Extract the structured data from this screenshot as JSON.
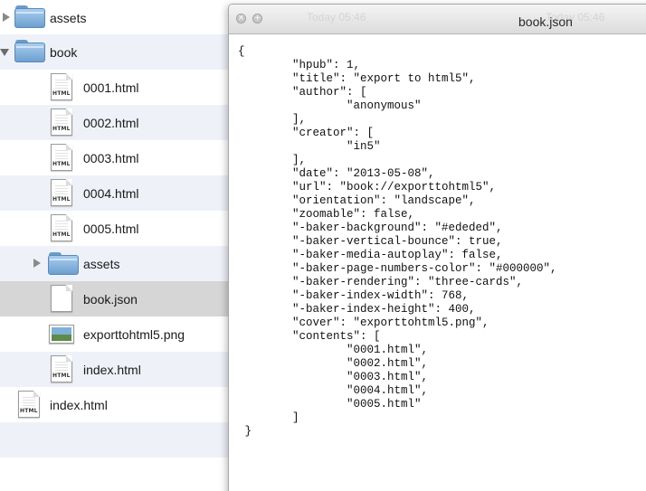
{
  "finder": {
    "rows": [
      {
        "label": "assets",
        "icon": "folder-icon"
      },
      {
        "label": "book",
        "icon": "folder-icon"
      },
      {
        "label": "0001.html",
        "icon": "html-file-icon",
        "badge": "HTML"
      },
      {
        "label": "0002.html",
        "icon": "html-file-icon",
        "badge": "HTML"
      },
      {
        "label": "0003.html",
        "icon": "html-file-icon",
        "badge": "HTML"
      },
      {
        "label": "0004.html",
        "icon": "html-file-icon",
        "badge": "HTML"
      },
      {
        "label": "0005.html",
        "icon": "html-file-icon",
        "badge": "HTML"
      },
      {
        "label": "assets",
        "icon": "folder-icon"
      },
      {
        "label": "book.json",
        "icon": "blank-file-icon",
        "selected": true
      },
      {
        "label": "exporttohtml5.png",
        "icon": "image-file-icon"
      },
      {
        "label": "index.html",
        "icon": "html-file-icon",
        "badge": "HTML"
      },
      {
        "label": "index.html",
        "icon": "html-file-icon",
        "badge": "HTML"
      }
    ]
  },
  "editor": {
    "title": "book.json",
    "background_titles": [
      "Today 05:46",
      "Today 05:46"
    ],
    "lines": [
      "{",
      "        \"hpub\": 1,",
      "        \"title\": \"export to html5\",",
      "        \"author\": [",
      "                \"anonymous\"",
      "        ],",
      "        \"creator\": [",
      "                \"in5\"",
      "        ],",
      "        \"date\": \"2013-05-08\",",
      "        \"url\": \"book://exporttohtml5\",",
      "        \"orientation\": \"landscape\",",
      "        \"zoomable\": false,",
      "        \"-baker-background\": \"#ededed\",",
      "        \"-baker-vertical-bounce\": true,",
      "        \"-baker-media-autoplay\": false,",
      "        \"-baker-page-numbers-color\": \"#000000\",",
      "        \"-baker-rendering\": \"three-cards\",",
      "        \"-baker-index-width\": 768,",
      "        \"-baker-index-height\": 400,",
      "        \"cover\": \"exporttohtml5.png\",",
      "        \"contents\": [",
      "                \"0001.html\",",
      "                \"0002.html\",",
      "                \"0003.html\",",
      "                \"0004.html\",",
      "                \"0005.html\"",
      "        ]",
      " }"
    ]
  },
  "colors": {
    "row_alt": "#eef2f8",
    "row_selected": "#d6d6d6",
    "folder": "#7eaad6"
  }
}
